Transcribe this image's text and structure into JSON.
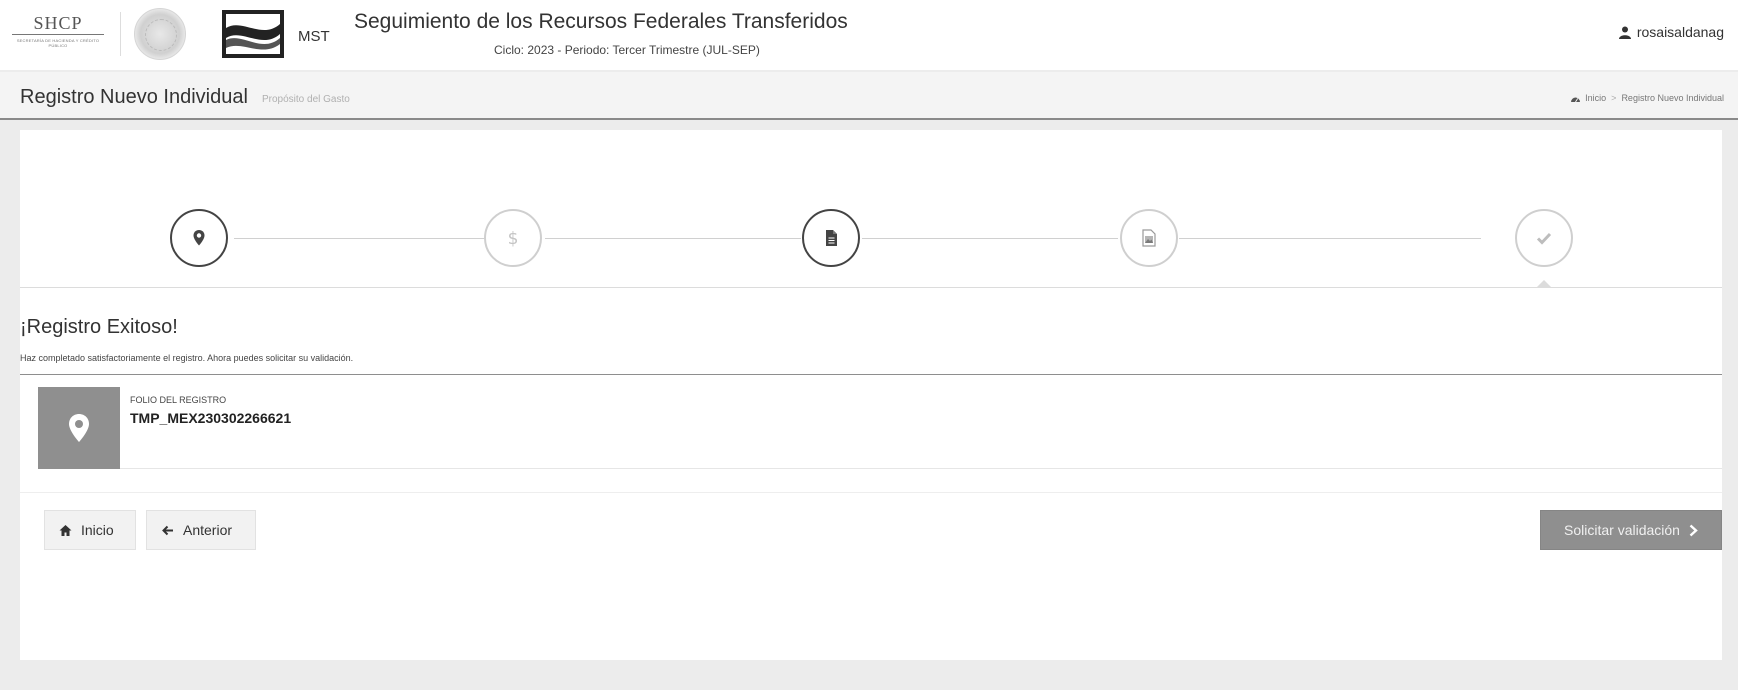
{
  "topbar": {
    "shcp_logo": {
      "main": "SHCP",
      "sub": "Secretaría de Hacienda y Crédito Público"
    },
    "mst_label": "MST",
    "app_title": "Seguimiento de los Recursos Federales Transferidos",
    "cycle": "Ciclo: 2023 - Periodo: Tercer Trimestre (JUL-SEP)",
    "user": {
      "icon": "user-icon",
      "name": "rosaisaldanag"
    }
  },
  "page_header": {
    "title": "Registro Nuevo Individual",
    "subtitle": "Propósito del Gasto",
    "breadcrumb": {
      "home_icon": "dashboard-icon",
      "home": "Inicio",
      "separator": ">",
      "current": "Registro Nuevo Individual"
    }
  },
  "wizard": {
    "steps": [
      {
        "icon": "map-marker-icon",
        "state": "done"
      },
      {
        "icon": "dollar-icon",
        "state": "inactive"
      },
      {
        "icon": "document-icon",
        "state": "done"
      },
      {
        "icon": "image-icon",
        "state": "inactive"
      },
      {
        "icon": "check-icon",
        "state": "current"
      }
    ]
  },
  "result": {
    "title": "¡Registro Exitoso!",
    "message": "Haz completado satisfactoriamente el registro. Ahora puedes solicitar su validación.",
    "folio": {
      "icon": "map-marker-icon",
      "label": "FOLIO DEL REGISTRO",
      "value": "TMP_MEX230302266621"
    }
  },
  "actions": {
    "home": {
      "label": "Inicio",
      "icon": "home-icon"
    },
    "previous": {
      "label": "Anterior",
      "icon": "arrow-left-icon"
    },
    "request_validation": {
      "label": "Solicitar validación",
      "icon": "chevron-right-icon"
    }
  },
  "colors": {
    "panel_bg": "#ffffff",
    "page_bg": "#ececec",
    "step_active_border": "#444444",
    "step_inactive_border": "#cfcfcf",
    "primary_button": "#8f8f8f",
    "folio_icon_bg": "#8f8f8f"
  }
}
